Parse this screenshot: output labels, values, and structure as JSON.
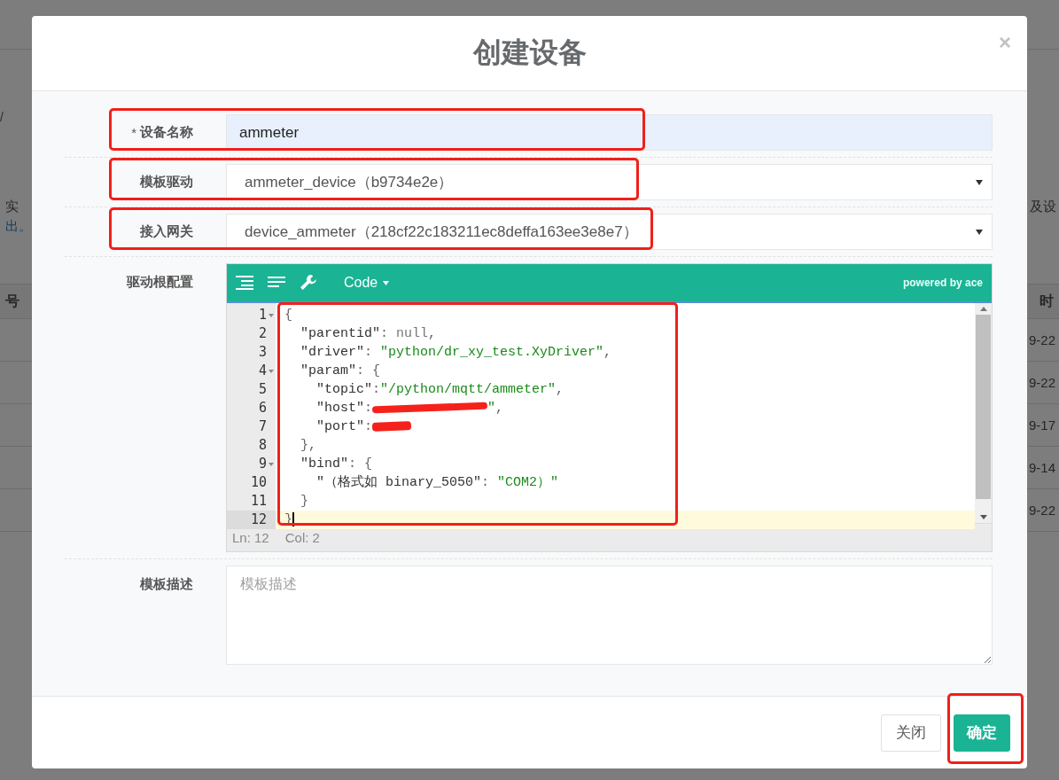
{
  "background": {
    "left": {
      "breadcrumb": "/",
      "notice_lines": [
        "实",
        "出。"
      ],
      "column_header": "号"
    },
    "right": {
      "notice": "及设",
      "column_header": "时",
      "cells": [
        "9-22",
        "9-22",
        "9-17",
        "9-14",
        "9-22"
      ]
    }
  },
  "dialog": {
    "title": "创建设备",
    "close": "×",
    "fields": [
      {
        "kind": "input",
        "label": "设备名称",
        "required_mark": "*",
        "value": "ammeter",
        "annotated": true
      },
      {
        "kind": "select",
        "label": "模板驱动",
        "value": "ammeter_device（b9734e2e）",
        "annotated": true
      },
      {
        "kind": "select",
        "label": "接入网关",
        "value": "device_ammeter（218cf22c183211ec8deffa163ee3e8e7）",
        "annotated": true
      },
      {
        "kind": "editor",
        "label": "驱动根配置",
        "annotated": true,
        "editor": {
          "mode": "Code",
          "credit": "powered by ace",
          "status": [
            "Ln: 12",
            "Col: 2"
          ],
          "lines": [
            {
              "number": "1",
              "foldable": true,
              "active": false,
              "parts": [
                {
                  "kind": "punct",
                  "text": "{"
                }
              ]
            },
            {
              "number": "2",
              "foldable": false,
              "active": false,
              "parts": [
                {
                  "kind": "key",
                  "text": "  \"parentid\""
                },
                {
                  "kind": "punct",
                  "text": ": "
                },
                {
                  "kind": "null",
                  "text": "null"
                },
                {
                  "kind": "punct",
                  "text": ","
                }
              ]
            },
            {
              "number": "3",
              "foldable": false,
              "active": false,
              "parts": [
                {
                  "kind": "key",
                  "text": "  \"driver\""
                },
                {
                  "kind": "punct",
                  "text": ": "
                },
                {
                  "kind": "string",
                  "text": "\"python/dr_xy_test.XyDriver\""
                },
                {
                  "kind": "punct",
                  "text": ","
                }
              ]
            },
            {
              "number": "4",
              "foldable": true,
              "active": false,
              "parts": [
                {
                  "kind": "key",
                  "text": "  \"param\""
                },
                {
                  "kind": "punct",
                  "text": ": {"
                }
              ]
            },
            {
              "number": "5",
              "foldable": false,
              "active": false,
              "parts": [
                {
                  "kind": "key",
                  "text": "    \"topic\""
                },
                {
                  "kind": "punct",
                  "text": ":"
                },
                {
                  "kind": "string",
                  "text": "\"/python/mqtt/ammeter\""
                },
                {
                  "kind": "punct",
                  "text": ","
                }
              ]
            },
            {
              "number": "6",
              "foldable": false,
              "active": false,
              "parts": [
                {
                  "kind": "key",
                  "text": "    \"host\""
                },
                {
                  "kind": "punct",
                  "text": ":"
                },
                {
                  "kind": "redacted"
                },
                {
                  "kind": "string",
                  "text": "\""
                },
                {
                  "kind": "punct",
                  "text": ","
                }
              ]
            },
            {
              "number": "7",
              "foldable": false,
              "active": false,
              "parts": [
                {
                  "kind": "key",
                  "text": "    \"port\""
                },
                {
                  "kind": "punct",
                  "text": ":"
                },
                {
                  "kind": "redacted"
                }
              ]
            },
            {
              "number": "8",
              "foldable": false,
              "active": false,
              "parts": [
                {
                  "kind": "punct",
                  "text": "  },"
                }
              ]
            },
            {
              "number": "9",
              "foldable": true,
              "active": false,
              "parts": [
                {
                  "kind": "key",
                  "text": "  \"bind\""
                },
                {
                  "kind": "punct",
                  "text": ": {"
                }
              ]
            },
            {
              "number": "10",
              "foldable": false,
              "active": false,
              "parts": [
                {
                  "kind": "key",
                  "text": "    \"（格式如 binary_5050\""
                },
                {
                  "kind": "punct",
                  "text": ": "
                },
                {
                  "kind": "string",
                  "text": "\"COM2）\""
                }
              ]
            },
            {
              "number": "11",
              "foldable": false,
              "active": false,
              "parts": [
                {
                  "kind": "punct",
                  "text": "  }"
                }
              ]
            },
            {
              "number": "12",
              "foldable": false,
              "active": true,
              "parts": [
                {
                  "kind": "punct",
                  "text": "}"
                }
              ]
            }
          ]
        }
      },
      {
        "kind": "textarea",
        "label": "模板描述",
        "placeholder": "模板描述",
        "annotated": false
      }
    ],
    "buttons": [
      {
        "kind": "secondary",
        "label": "关闭",
        "annotated": false
      },
      {
        "kind": "primary",
        "label": "确定",
        "annotated": true
      }
    ]
  }
}
